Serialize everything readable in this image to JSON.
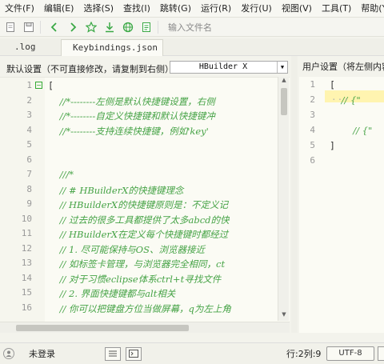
{
  "menu": [
    "文件(F)",
    "编辑(E)",
    "选择(S)",
    "查找(I)",
    "跳转(G)",
    "运行(R)",
    "发行(U)",
    "视图(V)",
    "工具(T)",
    "帮助(Y)"
  ],
  "toolbar": {
    "icons": [
      "new-file-icon",
      "save-icon",
      "back-icon",
      "forward-icon",
      "favorite-icon",
      "download-icon",
      "browser-icon",
      "document-icon"
    ],
    "search_placeholder": "输入文件名"
  },
  "tabs": [
    {
      "label": ".log",
      "active": false
    },
    {
      "label": "Keybindings.json",
      "active": true
    }
  ],
  "left_panel": {
    "label": "默认设置（不可直接修改，请复制到右侧）",
    "scheme_selected": "HBuilder X",
    "lines": [
      {
        "n": "1",
        "text": "[",
        "type": "bracket",
        "fold": true
      },
      {
        "n": "2",
        "text": "    //*--------左侧是默认快捷键设置，右侧",
        "type": "comment"
      },
      {
        "n": "3",
        "text": "    //*--------自定义快捷键和默认快捷键冲",
        "type": "comment"
      },
      {
        "n": "4",
        "text": "    //*--------支持连续快捷键，例如'key'",
        "type": "comment"
      },
      {
        "n": "5",
        "text": "",
        "type": "comment"
      },
      {
        "n": "6",
        "text": "",
        "type": "comment"
      },
      {
        "n": "7",
        "text": "    ///*",
        "type": "comment"
      },
      {
        "n": "8",
        "text": "    // # HBuilderX的快捷键理念",
        "type": "comment"
      },
      {
        "n": "9",
        "text": "    // HBuilderX的快捷键原则是：不定义记",
        "type": "comment"
      },
      {
        "n": "10",
        "text": "    // 过去的很多工具都提供了太多abcd的快",
        "type": "comment"
      },
      {
        "n": "11",
        "text": "    // HBuilderX在定义每个快捷键时都经过",
        "type": "comment"
      },
      {
        "n": "12",
        "text": "    // 1. 尽可能保持与OS、浏览器接近",
        "type": "comment"
      },
      {
        "n": "13",
        "text": "    // 如标签卡管理，与浏览器完全相同，ct",
        "type": "comment"
      },
      {
        "n": "14",
        "text": "    // 对于习惯eclipse体系ctrl+t寻找文件",
        "type": "comment"
      },
      {
        "n": "15",
        "text": "    // 2. 界面快捷键都与alt相关",
        "type": "comment"
      },
      {
        "n": "16",
        "text": "    // 你可以把键盘方位当做屏幕，q为左上角",
        "type": "comment"
      }
    ]
  },
  "right_panel": {
    "label": "用户设置（将左侧内容",
    "lines": [
      {
        "n": "1",
        "text": "[",
        "type": "bracket"
      },
      {
        "n": "2",
        "text": "    // {\"",
        "type": "comment"
      },
      {
        "n": "3",
        "text": "",
        "type": "comment"
      },
      {
        "n": "4",
        "text": "        // {\"",
        "type": "comment"
      },
      {
        "n": "5",
        "text": "]",
        "type": "bracket"
      },
      {
        "n": "6",
        "text": "",
        "type": "comment"
      }
    ]
  },
  "status": {
    "login": "未登录",
    "position": "行:2列:9",
    "encoding": "UTF-8"
  },
  "colors": {
    "comment": "#46a346",
    "fold": "#33aa33",
    "highlight": "#fff4b0",
    "editor_bg": "#fbfbf4"
  }
}
